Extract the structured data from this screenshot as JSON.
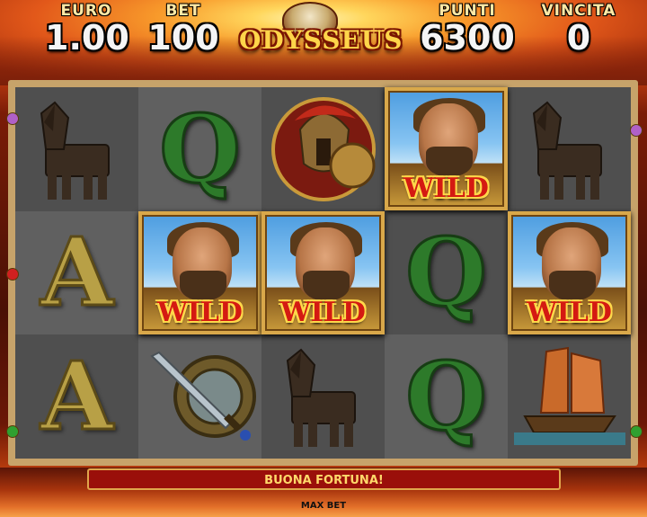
{
  "hud": {
    "euro": {
      "label": "EURO",
      "value": "1.00"
    },
    "bet": {
      "label": "BET",
      "value": "100"
    },
    "punti": {
      "label": "PUNTI",
      "value": "6300"
    },
    "vincita": {
      "label": "VINCITA",
      "value": "0"
    }
  },
  "logo": {
    "text": "ODYSSEUS"
  },
  "reels": [
    [
      "trojan-horse",
      "letter-a",
      "letter-a"
    ],
    [
      "letter-q",
      "wild",
      "shield-sword"
    ],
    [
      "spartan-warrior",
      "wild",
      "trojan-horse"
    ],
    [
      "wild",
      "letter-q",
      "letter-q"
    ],
    [
      "trojan-horse",
      "wild",
      "ship"
    ]
  ],
  "symbols": {
    "wild_label": "WILD",
    "letter_q": "Q",
    "letter_a": "A"
  },
  "message": "BUONA FORTUNA!",
  "max_bet_label": "MAX BET",
  "colors": {
    "frame": "#c7a36a",
    "message_bar": "#9a0f0a",
    "message_text": "#ffd86a",
    "wild_text": "#d41a12"
  }
}
